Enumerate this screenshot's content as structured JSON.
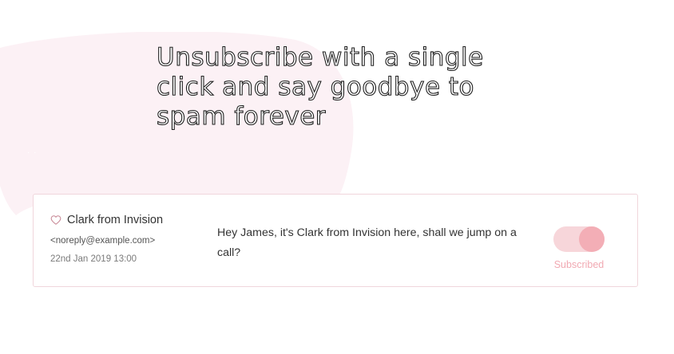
{
  "headline": "Unsubscribe with a single click and say goodbye to spam forever",
  "colors": {
    "blob": "#fcf1f5",
    "card_border": "#f0d6dc",
    "toggle_track": "#f7d6da",
    "toggle_knob": "#f3aeb6",
    "toggle_label": "#f1a9b2"
  },
  "email": {
    "favorite_icon": "heart-outline-icon",
    "sender_name": "Clark from Invision",
    "sender_email": "<noreply@example.com>",
    "date": "22nd Jan 2019 13:00",
    "preview": "Hey James, it's Clark from Invision here, shall we jump on a call?",
    "subscription": {
      "state": "on",
      "label": "Subscribed"
    }
  }
}
